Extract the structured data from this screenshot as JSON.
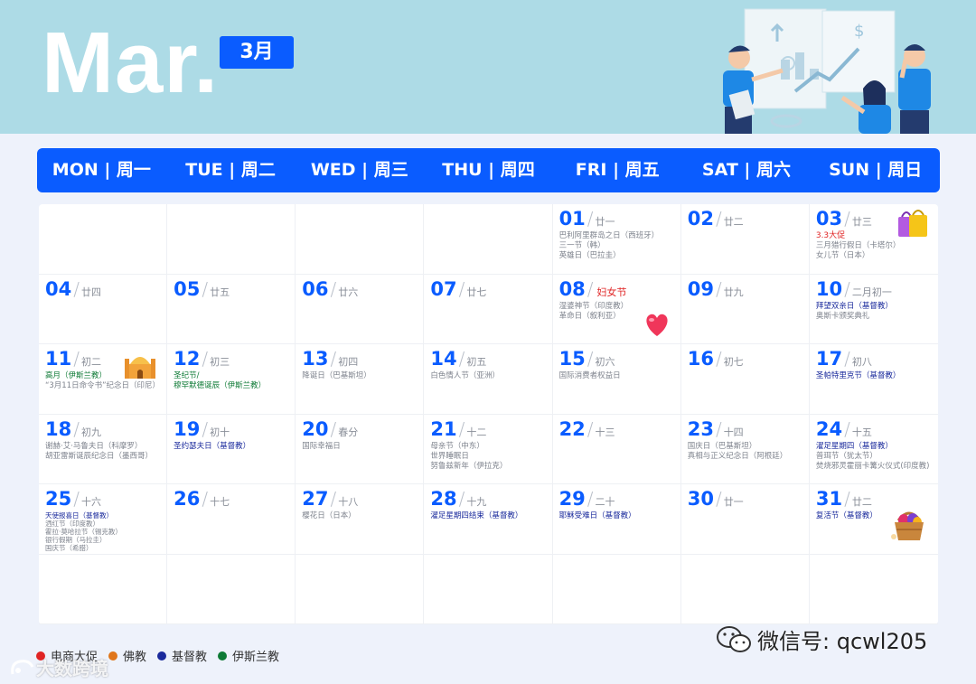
{
  "header": {
    "month_en": "Mar.",
    "month_badge": "3月"
  },
  "weekdays": [
    "MON | 周一",
    "TUE | 周二",
    "WED | 周三",
    "THU | 周四",
    "FRI | 周五",
    "SAT | 周六",
    "SUN | 周日"
  ],
  "days": [
    {},
    {},
    {},
    {},
    {
      "num": "01",
      "lunar": "廿一",
      "events": [
        {
          "t": "巴利阿里群岛之日（西班牙）",
          "c": "gray"
        },
        {
          "t": "三一节（韩）",
          "c": "gray"
        },
        {
          "t": "英雄日（巴拉圭）",
          "c": "gray"
        }
      ]
    },
    {
      "num": "02",
      "lunar": "廿二",
      "events": []
    },
    {
      "num": "03",
      "lunar": "廿三",
      "promo": "3.3大促",
      "events": [
        {
          "t": "三月猎行假日（卡塔尔）",
          "c": "gray"
        },
        {
          "t": "女儿节（日本）",
          "c": "gray"
        }
      ]
    },
    {
      "num": "04",
      "lunar": "廿四",
      "events": []
    },
    {
      "num": "05",
      "lunar": "廿五",
      "events": []
    },
    {
      "num": "06",
      "lunar": "廿六",
      "events": []
    },
    {
      "num": "07",
      "lunar": "廿七",
      "events": []
    },
    {
      "num": "08",
      "lunar": "",
      "special": "妇女节",
      "events": [
        {
          "t": "湿婆神节（印度教）",
          "c": "gray"
        },
        {
          "t": "革命日（叙利亚）",
          "c": "gray"
        }
      ]
    },
    {
      "num": "09",
      "lunar": "廿九",
      "events": []
    },
    {
      "num": "10",
      "lunar": "二月初一",
      "events": [
        {
          "t": "拜望双亲日（基督教）",
          "c": "blue"
        },
        {
          "t": "奥斯卡颁奖典礼",
          "c": "gray"
        }
      ]
    },
    {
      "num": "11",
      "lunar": "初二",
      "events": [
        {
          "t": "高月（伊斯兰教）",
          "c": "green"
        },
        {
          "t": "“3月11日命令书”纪念日（印尼）",
          "c": "gray"
        }
      ]
    },
    {
      "num": "12",
      "lunar": "初三",
      "events": [
        {
          "t": "圣纪节/",
          "c": "green"
        },
        {
          "t": "穆罕默德诞辰（伊斯兰教）",
          "c": "green"
        }
      ]
    },
    {
      "num": "13",
      "lunar": "初四",
      "events": [
        {
          "t": "降诞日（巴基斯坦）",
          "c": "gray"
        }
      ]
    },
    {
      "num": "14",
      "lunar": "初五",
      "events": [
        {
          "t": "白色情人节（亚洲）",
          "c": "gray"
        }
      ]
    },
    {
      "num": "15",
      "lunar": "初六",
      "events": [
        {
          "t": "国际消费者权益日",
          "c": "gray"
        }
      ]
    },
    {
      "num": "16",
      "lunar": "初七",
      "events": []
    },
    {
      "num": "17",
      "lunar": "初八",
      "events": [
        {
          "t": "圣帕特里克节（基督教）",
          "c": "blue"
        }
      ]
    },
    {
      "num": "18",
      "lunar": "初九",
      "events": [
        {
          "t": "谢赫·艾·马鲁夫日（科摩罗）",
          "c": "gray"
        },
        {
          "t": "胡亚雷斯诞辰纪念日（墨西哥）",
          "c": "gray"
        }
      ]
    },
    {
      "num": "19",
      "lunar": "初十",
      "events": [
        {
          "t": "圣约瑟夫日（基督教）",
          "c": "blue"
        }
      ]
    },
    {
      "num": "20",
      "lunar": "春分",
      "events": [
        {
          "t": "国际幸福日",
          "c": "gray"
        }
      ]
    },
    {
      "num": "21",
      "lunar": "十二",
      "events": [
        {
          "t": "母亲节（中东）",
          "c": "gray"
        },
        {
          "t": "世界睡眠日",
          "c": "gray"
        },
        {
          "t": "努鲁兹新年（伊拉克）",
          "c": "gray"
        }
      ]
    },
    {
      "num": "22",
      "lunar": "十三",
      "events": []
    },
    {
      "num": "23",
      "lunar": "十四",
      "events": [
        {
          "t": "国庆日（巴基斯坦）",
          "c": "gray"
        },
        {
          "t": "真相与正义纪念日（阿根廷）",
          "c": "gray"
        }
      ]
    },
    {
      "num": "24",
      "lunar": "十五",
      "events": [
        {
          "t": "濯足星期四（基督教）",
          "c": "blue"
        },
        {
          "t": "普珥节（犹太节）",
          "c": "gray"
        },
        {
          "t": "焚烧邪灵霍丽卡篝火仪式(印度教)",
          "c": "gray"
        }
      ]
    },
    {
      "num": "25",
      "lunar": "十六",
      "small": true,
      "events": [
        {
          "t": "天使报喜日（基督教）",
          "c": "blue"
        },
        {
          "t": "洒红节（印度教）",
          "c": "gray"
        },
        {
          "t": "霍拉·莫哈拉节（锡克教）",
          "c": "gray"
        },
        {
          "t": "银行假期（马拉圭）",
          "c": "gray"
        },
        {
          "t": "国庆节（希腊）",
          "c": "gray"
        }
      ]
    },
    {
      "num": "26",
      "lunar": "十七",
      "events": []
    },
    {
      "num": "27",
      "lunar": "十八",
      "events": [
        {
          "t": "樱花日（日本）",
          "c": "gray"
        }
      ]
    },
    {
      "num": "28",
      "lunar": "十九",
      "events": [
        {
          "t": "濯足星期四结束（基督教）",
          "c": "blue"
        }
      ]
    },
    {
      "num": "29",
      "lunar": "二十",
      "events": [
        {
          "t": "耶稣受难日（基督教）",
          "c": "blue"
        }
      ]
    },
    {
      "num": "30",
      "lunar": "廿一",
      "events": []
    },
    {
      "num": "31",
      "lunar": "廿二",
      "events": [
        {
          "t": "复活节（基督教）",
          "c": "blue"
        }
      ]
    },
    {},
    {},
    {},
    {},
    {},
    {},
    {}
  ],
  "legend": [
    {
      "label": "电商大促",
      "color": "#e02424"
    },
    {
      "label": "佛教",
      "color": "#e0761a"
    },
    {
      "label": "基督教",
      "color": "#1a2a9c"
    },
    {
      "label": "伊斯兰教",
      "color": "#0e7a35"
    }
  ],
  "watermark_left": "大数跨境",
  "watermark_right": "微信号: qcwl205",
  "icons": {
    "day03": "shopping-bags-icon",
    "day08": "heart-icon",
    "day11": "mosque-icon",
    "day31": "easter-basket-icon"
  }
}
